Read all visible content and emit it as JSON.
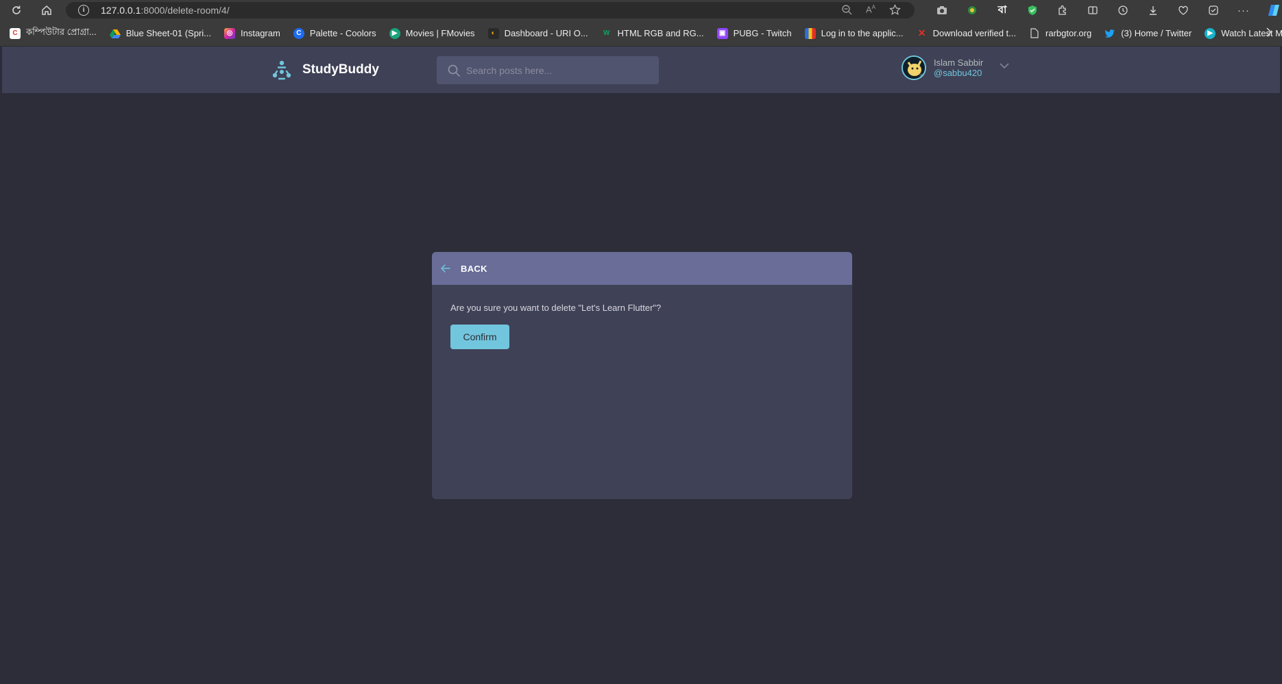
{
  "browser": {
    "url_host": "127.0.0.1",
    "url_rest": ":8000/delete-room/4/",
    "bookmarks": [
      {
        "label": "কম্পিউটার প্রোগ্রা...",
        "color": "#e8342f",
        "glyph": "C"
      },
      {
        "label": "Blue Sheet-01 (Spri...",
        "color": "#2f8a3c",
        "glyph": "▲"
      },
      {
        "label": "Instagram",
        "color": "#d6249f",
        "glyph": "◎"
      },
      {
        "label": "Palette - Coolors",
        "color": "#1d6bf2",
        "glyph": "C"
      },
      {
        "label": "Movies | FMovies",
        "color": "#1aa37a",
        "glyph": "▶"
      },
      {
        "label": "Dashboard - URI O...",
        "color": "#222222",
        "glyph": "◐"
      },
      {
        "label": "HTML RGB and RG...",
        "color": "#0d7a4c",
        "glyph": "W"
      },
      {
        "label": "PUBG - Twitch",
        "color": "#9146ff",
        "glyph": "▣"
      },
      {
        "label": "Log in to the applic...",
        "color": "#f2a71b",
        "glyph": "▮"
      },
      {
        "label": "Download verified t...",
        "color": "#e0302a",
        "glyph": "✕"
      },
      {
        "label": "rarbgtor.org",
        "color": "#4a4a4a",
        "glyph": "▯"
      },
      {
        "label": "(3) Home / Twitter",
        "color": "#1da1f2",
        "glyph": "♥"
      },
      {
        "label": "Watch Latest Movie...",
        "color": "#17b3c9",
        "glyph": "▶"
      }
    ]
  },
  "header": {
    "brand": "StudyBuddy",
    "search_placeholder": "Search posts here...",
    "user_name": "Islam Sabbir",
    "user_handle": "@sabbu420"
  },
  "modal": {
    "back_label": "BACK",
    "question": "Are you sure you want to delete \"Let's Learn Flutter\"?",
    "confirm_label": "Confirm"
  },
  "colors": {
    "accent": "#71c6dd",
    "page_bg": "#2d2d39",
    "header_bg": "#3f4156",
    "modal_head": "#696d97"
  }
}
